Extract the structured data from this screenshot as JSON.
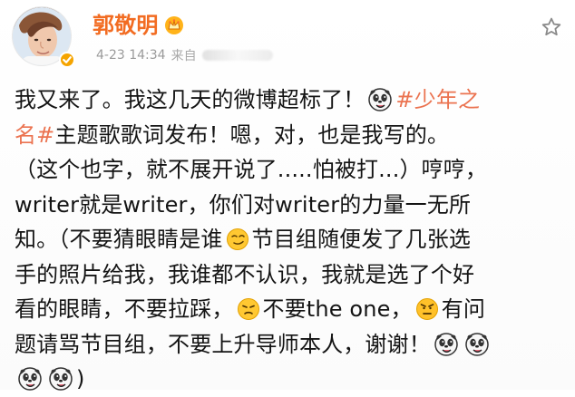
{
  "post": {
    "author": {
      "name": "郭敬明",
      "avatar_icon": "avatar",
      "crown_icon": "crown-icon",
      "verified_icon": "verified-icon"
    },
    "meta": {
      "time": "4-23 14:34",
      "source_prefix": "来自"
    },
    "actions": {
      "favorite_icon": "star-icon"
    },
    "body": {
      "line1_a": "我又来了。我这几天的微博超标了！",
      "line1_hashtag": "#少年之",
      "line2_hashtag": "名#",
      "line2_b": " 主题歌歌词发布！嗯，对，也是我写的。",
      "line3": "（这个也字，就不展开说了.....怕被打...）哼哼，",
      "line4": "writer就是writer，你们对writer的力量一无所",
      "line5_a": "知。（不要猜眼睛是谁",
      "line5_b": "节目组随便发了几张选",
      "line6": "手的照片给我，我谁都不认识，我就是选了个好",
      "line7_a": "看的眼睛，不要拉踩，",
      "line7_b": "不要the one，",
      "line7_c": "有问",
      "line8_a": "题请骂节目组，不要上升导师本人，谢谢！",
      "line9_a": ")"
    }
  },
  "colors": {
    "username": "#f26c22",
    "hashtag": "#eb7350",
    "meta": "#9a9a9a",
    "text": "#141414"
  }
}
